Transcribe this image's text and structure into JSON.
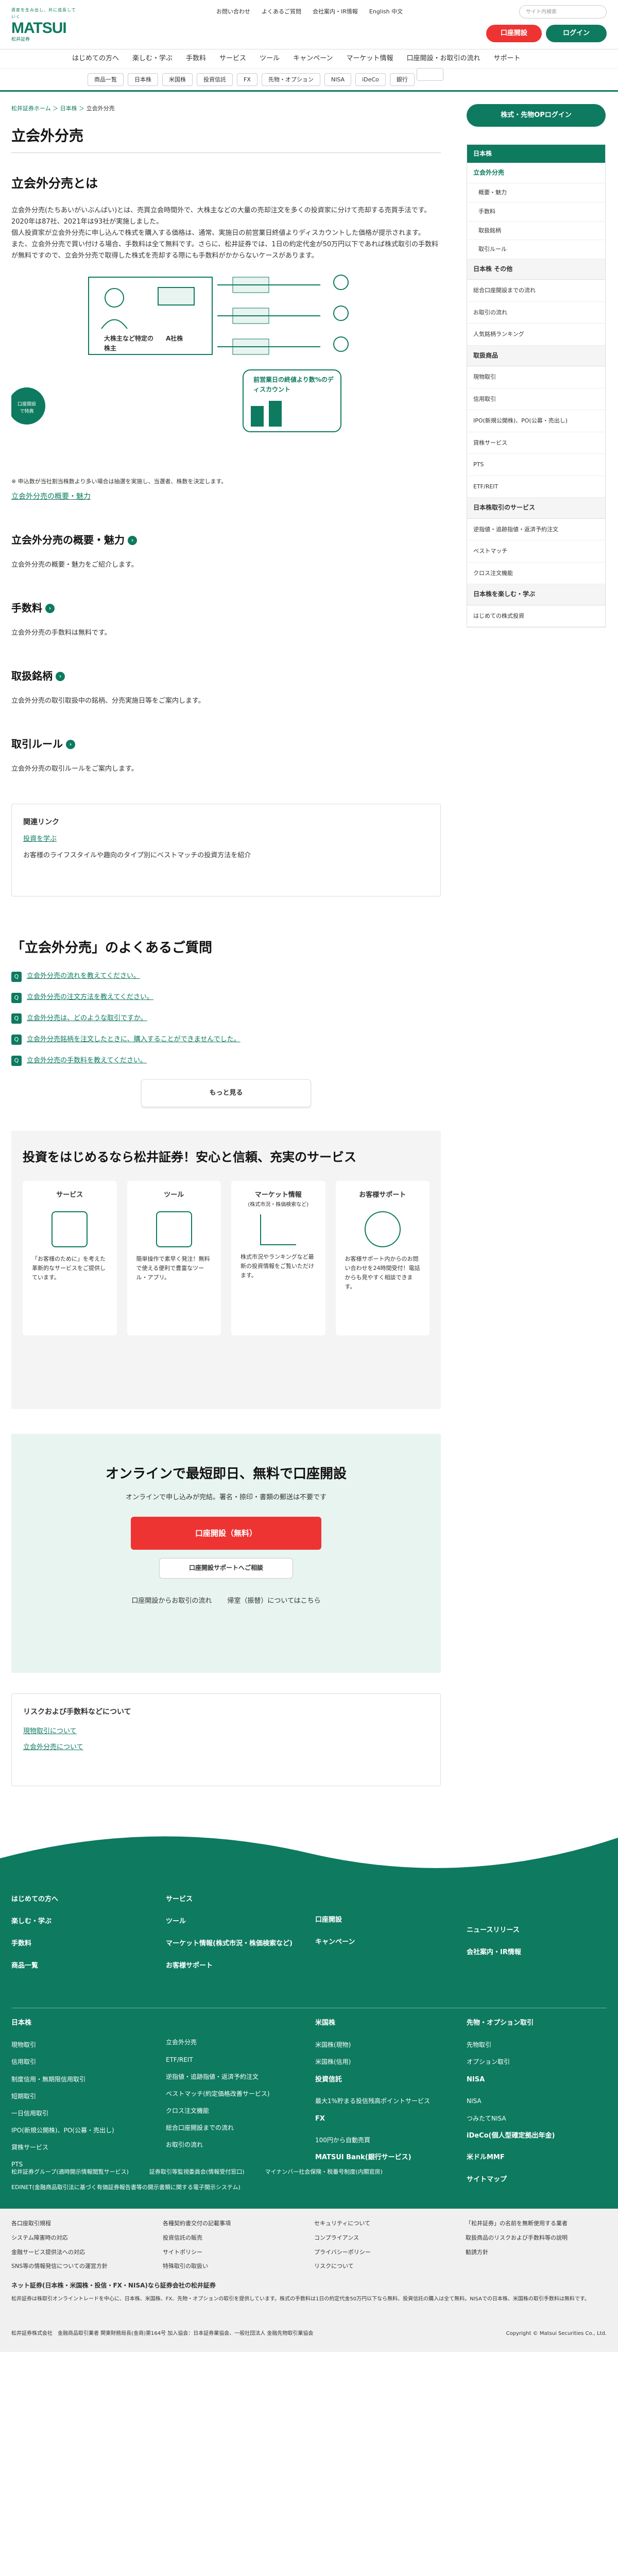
{
  "header": {
    "tagline": "資産を生み出し、共に成長していく",
    "logo": "MATSUI",
    "logo_sub": "松井証券",
    "util": [
      "お問い合わせ",
      "よくあるご質問",
      "会社案内・IR情報",
      "English 中文"
    ],
    "search_placeholder": "サイト内検索",
    "open_account": "口座開設",
    "login": "ログイン",
    "nav": [
      "はじめての方へ",
      "楽しむ・学ぶ",
      "手数料",
      "サービス",
      "ツール",
      "キャンペーン",
      "マーケット情報",
      "口座開設・お取引の流れ",
      "サポート"
    ],
    "subnav": [
      "商品一覧",
      "日本株",
      "米国株",
      "投資信託",
      "FX",
      "先物・オプション",
      "NISA",
      "iDeCo",
      "銀行"
    ],
    "new_badge": "NEW"
  },
  "breadcrumb": [
    "松井証券ホーム",
    "日本株",
    "立会外分売"
  ],
  "page_title": "立会外分売",
  "what": {
    "title": "立会外分売とは",
    "body": "立会外分売(たちあいがいぶんばい)とは、売買立会時間外で、大株主などの大量の売却注文を多くの投資家に分けて売却する売買手法です。2020年は87社、2021年は93社が実施しました。\n個人投資家が立会外分売に申し込んで株式を購入する価格は、通常、実施日の前営業日終値よりディスカウントした価格が提示されます。\nまた、立会外分売で買い付ける場合、手数料は全て無料です。さらに、松井証券では、1日の約定代金が50万円以下であれば株式取引の手数料が無料ですので、立会外分売で取得した株式を売却する際にも手数料がかからないケースがあります。",
    "illus": {
      "seller": "大株主など特定の株主",
      "company": "A社株",
      "discount": "前営業日の終値より数%のディスカウント",
      "callout": "口座開設で特典",
      "yen": "¥"
    },
    "note": "※ 申込数が当社割当株数より多い場合は抽選を実施し、当選者、株数を決定します。",
    "link": "立会外分売の概要・魅力"
  },
  "sections": [
    {
      "title": "立会外分売の概要・魅力",
      "body": "立会外分売の概要・魅力をご紹介します。"
    },
    {
      "title": "手数料",
      "body": "立会外分売の手数料は無料です。"
    },
    {
      "title": "取扱銘柄",
      "body": "立会外分売の取引取扱中の銘柄、分売実施日等をご案内します。"
    },
    {
      "title": "取引ルール",
      "body": "立会外分売の取引ルールをご案内します。"
    }
  ],
  "related": {
    "title": "関連リンク",
    "link": "投資を学ぶ",
    "desc": "お客様のライフスタイルや趣向のタイプ別にベストマッチの投資方法を紹介"
  },
  "faq": {
    "title": "「立会外分売」のよくあるご質問",
    "q": [
      "立会外分売の流れを教えてください。",
      "立会外分売の注文方法を教えてください。",
      "立会外分売は、どのような取引ですか。",
      "立会外分売銘柄を注文したときに、購入することができませんでした。",
      "立会外分売の手数料を教えてください。"
    ],
    "more": "もっと見る"
  },
  "service": {
    "title": "投資をはじめるなら松井証券！安心と信頼、充実のサービス",
    "cards": [
      {
        "t": "サービス",
        "d": "「お客様のために」を考えた革新的なサービスをご提供しています。"
      },
      {
        "t": "ツール",
        "d": "簡単操作で素早く発注！無料で使える便利で豊富なツール・アプリ。"
      },
      {
        "t": "マーケット情報",
        "sub": "(株式市況・株価検索など)",
        "d": "株式市況やランキングなど最新の投資情報をご覧いただけます。"
      },
      {
        "t": "お客様サポート",
        "d": "お客様サポート内からのお問い合わせを24時間受付！電話からも見やすく相談できます。"
      }
    ]
  },
  "open": {
    "title": "オンラインで最短即日、無料で口座開設",
    "sub": "オンラインで申し込みが完結。署名・捺印・書類の郵送は不要です",
    "cta": "口座開設（無料）",
    "support": "口座開設サポートへご相談",
    "l1": "口座開設からお取引の流れ",
    "l2": "帰室（振替）についてはこちら"
  },
  "risk": {
    "title": "リスクおよび手数料などについて",
    "l1": "現物取引について",
    "l2": "立会外分売について"
  },
  "sidebar": {
    "login": "株式・先物OPログイン",
    "head": "日本株",
    "active": "立会外分売",
    "items": [
      "概要・魅力",
      "手数料",
      "取扱銘柄",
      "取引ルール"
    ],
    "groups": [
      {
        "h": "日本株 その他",
        "items": [
          "総合口座開設までの流れ",
          "お取引の流れ",
          "人気銘柄ランキング"
        ]
      },
      {
        "h": "取扱商品",
        "items": [
          "現物取引",
          "信用取引",
          "IPO(新規公開株)、PO(公募・売出し)",
          "貸株サービス",
          "PTS",
          "ETF/REIT"
        ]
      },
      {
        "h": "日本株取引のサービス",
        "items": [
          "逆指値・追跡指値・返済予約注文",
          "ベストマッチ",
          "クロス注文機能"
        ]
      },
      {
        "h": "日本株を楽しむ・学ぶ",
        "items": [
          "はじめての株式投資"
        ]
      }
    ]
  },
  "footer": {
    "c1": [
      "はじめての方へ",
      "楽しむ・学ぶ",
      "手数料",
      "商品一覧"
    ],
    "c2": [
      "サービス",
      "ツール",
      "マーケット情報(株式市況・株価検索など)",
      "お客様サポート"
    ],
    "c3": [
      "口座開設",
      "キャンペーン"
    ],
    "c4": [
      "ニュースリリース",
      "会社案内・IR情報"
    ],
    "jp": [
      "日本株",
      "現物取引",
      "信用取引",
      "制度信用・無期限信用取引",
      "短期取引",
      "一日信用取引",
      "IPO(新規公開株)、PO(公募・売出し)",
      "貸株サービス",
      "PTS"
    ],
    "jp2": [
      "立会外分売",
      "ETF/REIT",
      "逆指値・追跡指値・返済予約注文",
      "ベストマッチ(約定価格改善サービス)",
      "クロス注文機能",
      "総合口座開設までの流れ",
      "お取引の流れ"
    ],
    "us": [
      "米国株",
      "米国株(現物)",
      "米国株(信用)",
      "投資信託",
      "最大1%貯まる投信残高ポイントサービス",
      "FX",
      "100円から自動売買",
      "MATSUI Bank(銀行サービス)"
    ],
    "fo": [
      "先物・オプション取引",
      "先物取引",
      "オプション取引",
      "NISA",
      "iDeCo(個人型確定拠出年金)",
      "米ドルMMF",
      "サイトマップ"
    ],
    "nisa": [
      "NISA",
      "つみたてNISA"
    ],
    "group": [
      "松井証券グループ(適時開示情報閲覧サービス)",
      "証券取引等監視委員会(情報受付窓口)",
      "マイナンバー社会保険・税番号制度(内閣官房)",
      "EDINET(金融商品取引法に基づく有価証券報告書等の開示書類に関する電子開示システム)"
    ],
    "bottom": [
      "各口座取引規程",
      "各種契約書交付の記載事項",
      "「松井証券」の名前を無断使用する業者",
      "システム障害時の対応",
      "投資信託の販売",
      "セキュリティについて",
      "特殊取引の取扱い",
      "取扱商品のリスクおよび手数料等の説明",
      "金融サービス提供法への対応",
      "サイトポリシー",
      "プライバシーポリシー",
      "コンプライアンス",
      "勧誘方針",
      "リスクについて",
      "SNS等の情報発信についての運営方針"
    ],
    "disc_title": "ネット証券(日本株・米国株・投信・FX・NISA)なら証券会社の松井証券",
    "disc": "松井証券は株取引オンライントレードを中心に、日本株、米国株、FX、先物・オプションの取引を提供しています。株式の手数料は1日の約定代金50万円以下なら無料、投資信託の購入は全て無料。NISAでの日本株、米国株の取引手数料は無料です。",
    "company": "松井証券株式会社　金融商品取引業者 関東財務局長(金商)第164号 加入協会：日本証券業協会、一般社団法人 金融先物取引業協会",
    "copy": "Copyright © Matsui Securities Co., Ltd."
  },
  "colors": {
    "brand": "#0e7a60",
    "accent": "#e33333"
  }
}
